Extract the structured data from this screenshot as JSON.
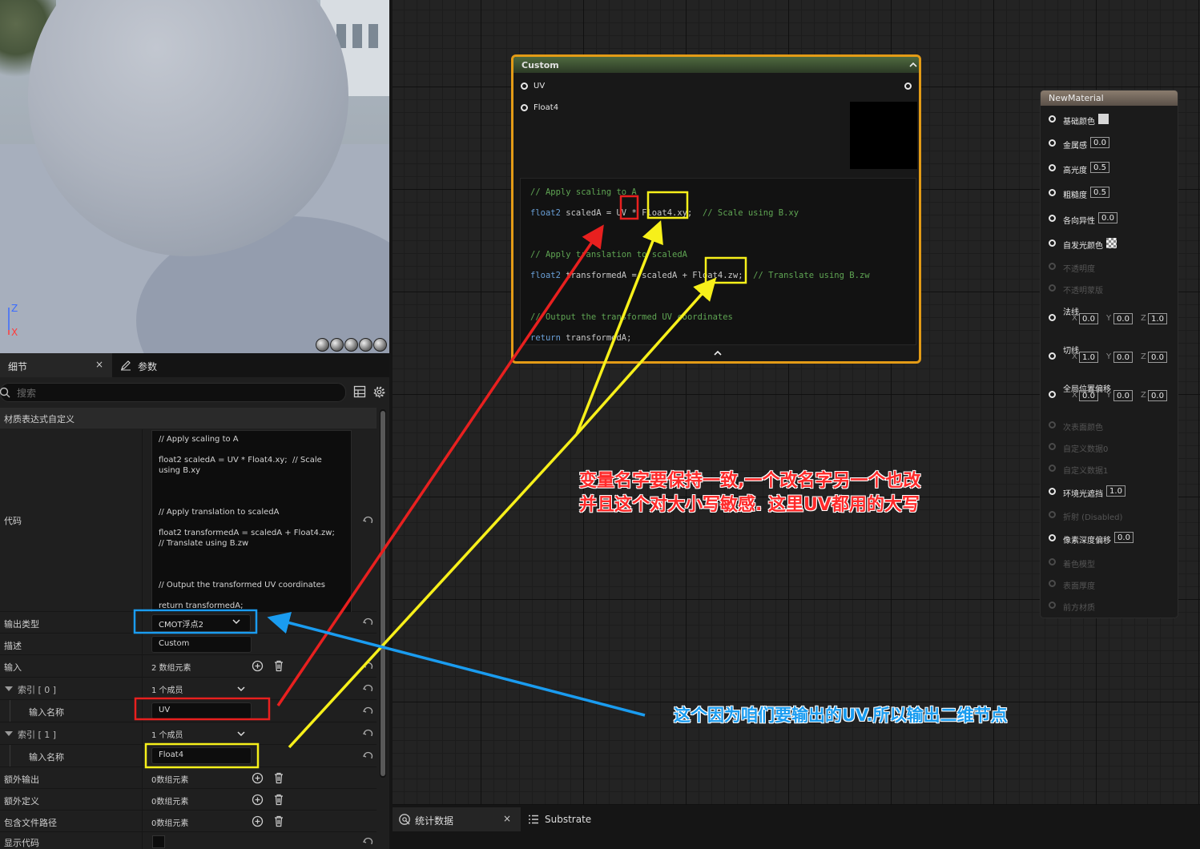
{
  "viewport": {
    "axis_z": "Z",
    "axis_x": "X"
  },
  "details": {
    "tab_details": "细节",
    "tab_close": "×",
    "tab_params": "参数",
    "search_placeholder": "搜索",
    "section_title": "材质表达式自定义",
    "code_label": "代码",
    "code_text": "// Apply scaling to A\n\nfloat2 scaledA = UV * Float4.xy;  // Scale using B.xy\n\n\n\n// Apply translation to scaledA\n\nfloat2 transformedA = scaledA + Float4.zw;  // Translate using B.zw\n\n\n\n// Output the transformed UV coordinates\n\nreturn transformedA;",
    "output_type_label": "输出类型",
    "output_type_value": "CMOT浮点2",
    "desc_label": "描述",
    "desc_value": "Custom",
    "inputs_label": "输入",
    "inputs_value": "2 数组元素",
    "index0_label": "索引 [ 0 ]",
    "index0_value": "1 个成员",
    "input_name_label": "输入名称",
    "input0_name": "UV",
    "index1_label": "索引 [ 1 ]",
    "index1_value": "1 个成员",
    "input1_name": "Float4",
    "extra_out_label": "额外输出",
    "extra_out_value": "0数组元素",
    "extra_def_label": "额外定义",
    "extra_def_value": "0数组元素",
    "include_label": "包含文件路径",
    "include_value": "0数组元素",
    "show_code_label": "显示代码"
  },
  "custom_node": {
    "title": "Custom",
    "pin_uv": "UV",
    "pin_float4": "Float4",
    "code_lines": [
      {
        "com": "// Apply scaling to A"
      },
      {
        "kw": "float2",
        "txt": " scaledA = UV * Float4.xy;  ",
        "com": "// Scale using B.xy"
      },
      {
        "txt": ""
      },
      {
        "com": "// Apply translation to scaledA"
      },
      {
        "kw": "float2",
        "txt": " transformedA = scaledA + Float4.zw;  ",
        "com": "// Translate using B.zw"
      },
      {
        "txt": ""
      },
      {
        "com": "// Output the transformed UV coordinates"
      },
      {
        "kw": "return",
        "txt": " transformedA;"
      }
    ]
  },
  "material_node": {
    "title": "NewMaterial",
    "rows": [
      {
        "label": "基础颜色",
        "type": "color",
        "enabled": true
      },
      {
        "label": "金属感",
        "value": "0.0",
        "enabled": true
      },
      {
        "label": "高光度",
        "value": "0.5",
        "enabled": true
      },
      {
        "label": "粗糙度",
        "value": "0.5",
        "enabled": true
      },
      {
        "label": "各向异性",
        "value": "0.0",
        "enabled": true
      },
      {
        "label": "自发光颜色",
        "type": "checker",
        "enabled": true
      },
      {
        "label": "不透明度",
        "enabled": false
      },
      {
        "label": "不透明蒙版",
        "enabled": false
      },
      {
        "label": "法线",
        "xyz": [
          "0.0",
          "0.0",
          "1.0"
        ],
        "enabled": true
      },
      {
        "label": "切线",
        "xyz": [
          "1.0",
          "0.0",
          "0.0"
        ],
        "enabled": true
      },
      {
        "label": "全局位置偏移",
        "xyz": [
          "0.0",
          "0.0",
          "0.0"
        ],
        "enabled": true
      },
      {
        "label": "次表面颜色",
        "enabled": false
      },
      {
        "label": "自定义数据0",
        "enabled": false
      },
      {
        "label": "自定义数据1",
        "enabled": false
      },
      {
        "label": "环境光遮挡",
        "value": "1.0",
        "enabled": true
      },
      {
        "label": "折射 (Disabled)",
        "enabled": false
      },
      {
        "label": "像素深度偏移",
        "value": "0.0",
        "enabled": true
      },
      {
        "label": "着色模型",
        "enabled": false
      },
      {
        "label": "表面厚度",
        "enabled": false
      },
      {
        "label": "前方材质",
        "enabled": false
      }
    ],
    "axis": [
      "X",
      "Y",
      "Z"
    ]
  },
  "bottom_tabs": {
    "stats": "统计数据",
    "close": "×",
    "substrate": "Substrate"
  },
  "annotations": {
    "red_line1": "变量名字要保持一致,一个改名字另一个也改",
    "red_line2": "并且这个对大小写敏感. 这里UV都用的大写",
    "blue_note": "这个因为咱们要输出的UV.所以输出二维节点",
    "colors": {
      "red": "#e8201f",
      "yellow": "#f7f01a",
      "blue": "#1a9cf0"
    }
  }
}
